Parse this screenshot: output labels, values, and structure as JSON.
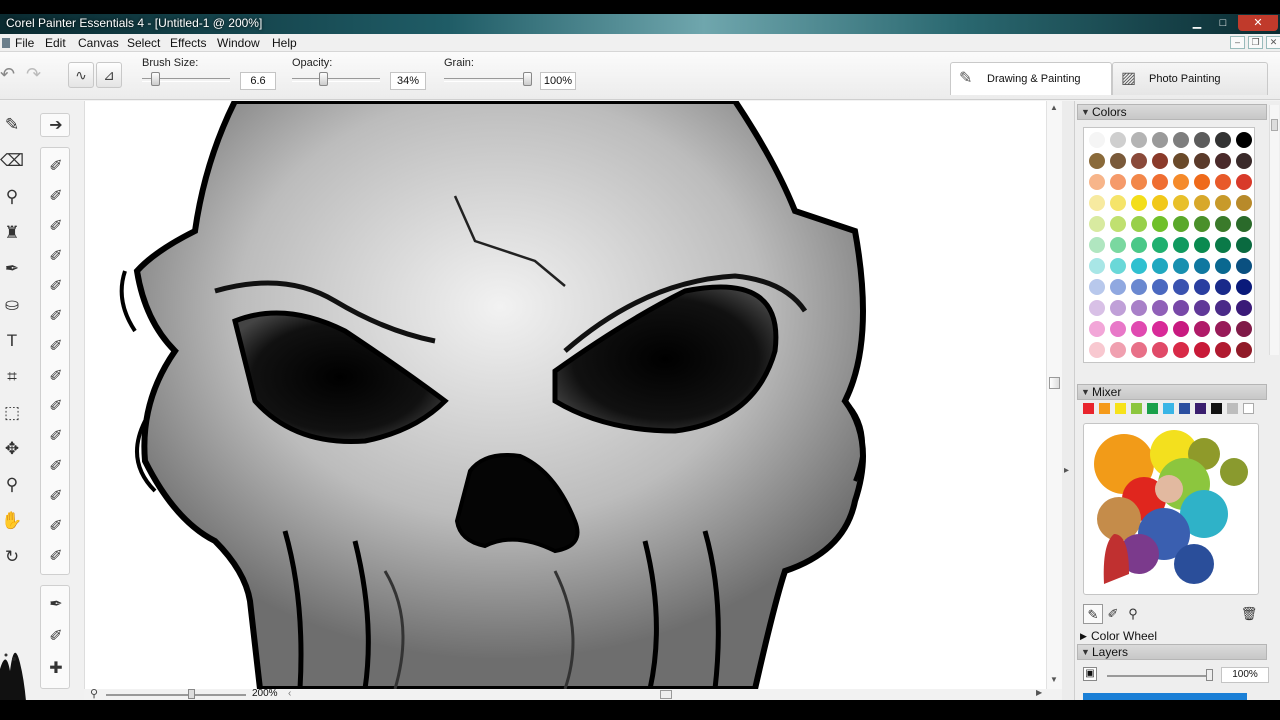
{
  "window": {
    "title": "Corel Painter Essentials 4 - [Untitled-1 @ 200%]",
    "minimize": "▁",
    "maximize": "□",
    "close": "✕"
  },
  "menu": {
    "items": [
      "File",
      "Edit",
      "Canvas",
      "Select",
      "Effects",
      "Window",
      "Help"
    ]
  },
  "property_bar": {
    "brush_size": {
      "label": "Brush Size:",
      "value": "6.6",
      "level": 0.12
    },
    "opacity": {
      "label": "Opacity:",
      "value": "34%",
      "level": 0.34
    },
    "grain": {
      "label": "Grain:",
      "value": "100%",
      "level": 1.0
    }
  },
  "workspace_tabs": [
    {
      "label": "Drawing & Painting",
      "icon": "brush-icon",
      "active": true
    },
    {
      "label": "Photo Painting",
      "icon": "photo-icon",
      "active": false
    }
  ],
  "toolbox": {
    "left_tools": [
      "brush-tool-icon",
      "eraser-tool-icon",
      "dropper-tool-icon",
      "clone-stamp-tool-icon",
      "pen-tool-icon",
      "paint-bucket-tool-icon",
      "text-tool-icon",
      "crop-tool-icon",
      "selection-tool-icon",
      "transform-tool-icon",
      "magnifier-tool-icon",
      "grabber-tool-icon",
      "rotate-page-tool-icon"
    ],
    "brush_variants_count": 14
  },
  "status": {
    "zoom": "200%"
  },
  "panels": {
    "colors": {
      "title": "Colors"
    },
    "mixer": {
      "title": "Mixer",
      "swatches": [
        "#e8242c",
        "#f59a1a",
        "#f7e21a",
        "#8cc63e",
        "#1aa04a",
        "#3ab5e6",
        "#2b4fa0",
        "#3a1e6e",
        "#111111",
        "#bdbdbd",
        "#ffffff"
      ]
    },
    "color_wheel": {
      "title": "Color Wheel"
    },
    "layers": {
      "title": "Layers",
      "opacity": "100%"
    }
  },
  "colors": {
    "accent": "#0078d7",
    "titlebar": "#1f5c66"
  }
}
